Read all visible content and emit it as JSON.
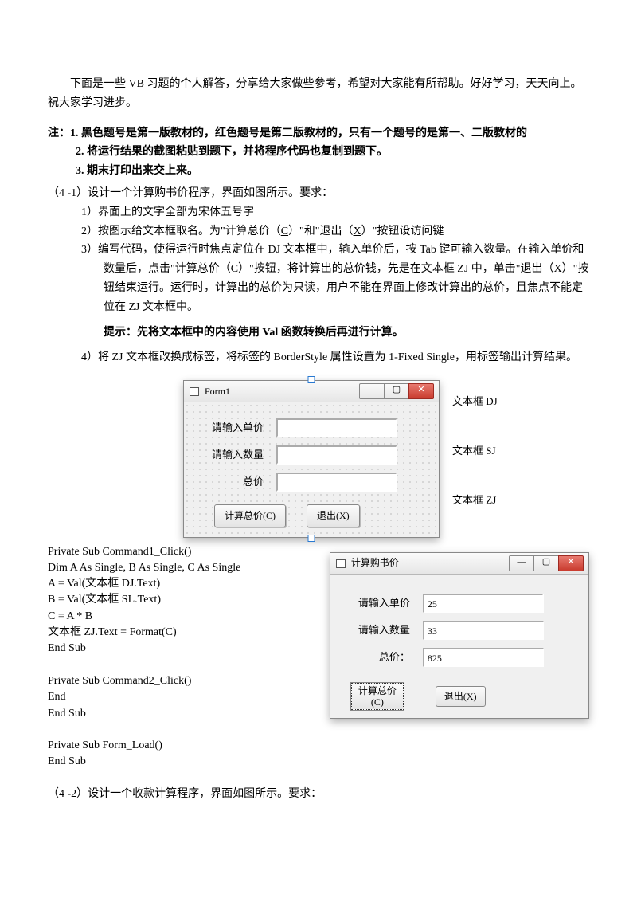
{
  "intro": "下面是一些 VB 习题的个人解答，分享给大家做些参考，希望对大家能有所帮助。好好学习，天天向上。祝大家学习进步。",
  "note_header": "注：1.  黑色题号是第一版教材的，红色题号是第二版教材的，只有一个题号的是第一、二版教材的",
  "note2": "2.  将运行结果的截图粘贴到题下，并将程序代码也复制到题下。",
  "note3": "3.  期末打印出来交上来。",
  "q41_title": "（4 -1）设计一个计算购书价程序，界面如图所示。要求：",
  "q41_1": "1）界面上的文字全部为宋体五号字",
  "q41_2_pre": "2）按图示给文本框取名。为\"计算总价（",
  "q41_2_c": "C",
  "q41_2_mid": "）\"和\"退出（",
  "q41_2_x": "X",
  "q41_2_post": "）\"按钮设访问键",
  "q41_3_a": "3）编写代码，使得运行时焦点定位在 DJ 文本框中，输入单价后，按 Tab 键可输入数量。在输入单价和数量后，点击\"计算总价（",
  "q41_3_c": "C",
  "q41_3_b": "）\"按钮，将计算出的总价钱，先是在文本框 ZJ 中，单击\"退出（",
  "q41_3_x": "X",
  "q41_3_c2": "）\"按钮结束运行。运行时，计算出的总价为只读，用户不能在界面上修改计算出的总价，且焦点不能定位在 ZJ 文本框中。",
  "tip": "提示：先将文本框中的内容使用 Val 函数转换后再进行计算。",
  "q41_4": "4）将 ZJ 文本框改换成标签，将标签的 BorderStyle 属性设置为 1-Fixed Single，用标签输出计算结果。",
  "form1": {
    "title": "Form1",
    "label_dj": "请输入单价",
    "label_sj": "请输入数量",
    "label_zj": "总价",
    "btn_calc": "计算总价(C)",
    "btn_exit": "退出(X)",
    "callout_dj": "文本框 DJ",
    "callout_sj": "文本框 SJ",
    "callout_zj": "文本框 ZJ"
  },
  "code": {
    "l01": "  Private Sub Command1_Click()",
    "l02": "Dim A As Single, B As Single, C As Single",
    "l03": "A = Val(文本框 DJ.Text)",
    "l04": "B = Val(文本框 SL.Text)",
    "l05": "C = A * B",
    "l06": "文本框 ZJ.Text = Format(C)",
    "l07": "End Sub",
    "l08": "",
    "l09": "Private Sub Command2_Click()",
    "l10": "End",
    "l11": "End Sub",
    "l12": "",
    "l13": "Private Sub Form_Load()",
    "l14": "End Sub"
  },
  "form2": {
    "title": "计算购书价",
    "label_dj": "请输入单价",
    "label_sj": "请输入数量",
    "label_zj": "总价：",
    "val_dj": "25",
    "val_sj": "33",
    "val_zj": "825",
    "btn_calc_line1": "计算总价",
    "btn_calc_line2": "(C)",
    "btn_exit": "退出(X)"
  },
  "q42_title": "（4 -2）设计一个收款计算程序，界面如图所示。要求："
}
